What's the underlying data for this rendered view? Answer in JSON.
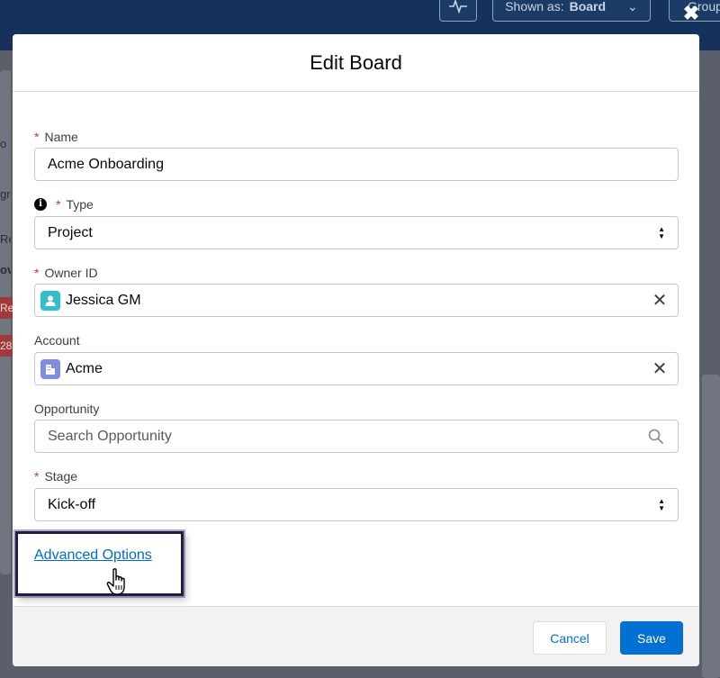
{
  "background": {
    "shown_as_label": "Shown as:",
    "shown_as_value": "Board",
    "group_label": "Group",
    "fragments": [
      "o",
      "gr",
      "Re",
      "ov",
      "Re",
      "28"
    ]
  },
  "modal": {
    "title": "Edit Board",
    "close_icon": "close-icon",
    "fields": {
      "name": {
        "label": "Name",
        "value": "Acme Onboarding",
        "required": "*"
      },
      "type": {
        "label": "Type",
        "value": "Project",
        "required": "*",
        "info_icon": "i"
      },
      "owner": {
        "label": "Owner ID",
        "value": "Jessica GM",
        "required": "*",
        "clear": "✕"
      },
      "account": {
        "label": "Account",
        "value": "Acme",
        "clear": "✕"
      },
      "opportunity": {
        "label": "Opportunity",
        "placeholder": "Search Opportunity"
      },
      "stage": {
        "label": "Stage",
        "value": "Kick-off",
        "required": "*"
      }
    },
    "advanced_options_link": "Advanced Options",
    "footer": {
      "cancel_label": "Cancel",
      "save_label": "Save"
    }
  },
  "colors": {
    "brand_blue": "#0070d2",
    "required_red": "#c23934",
    "user_icon": "#34becd",
    "account_icon": "#7f8de1",
    "highlight": "#1f1d4a"
  }
}
